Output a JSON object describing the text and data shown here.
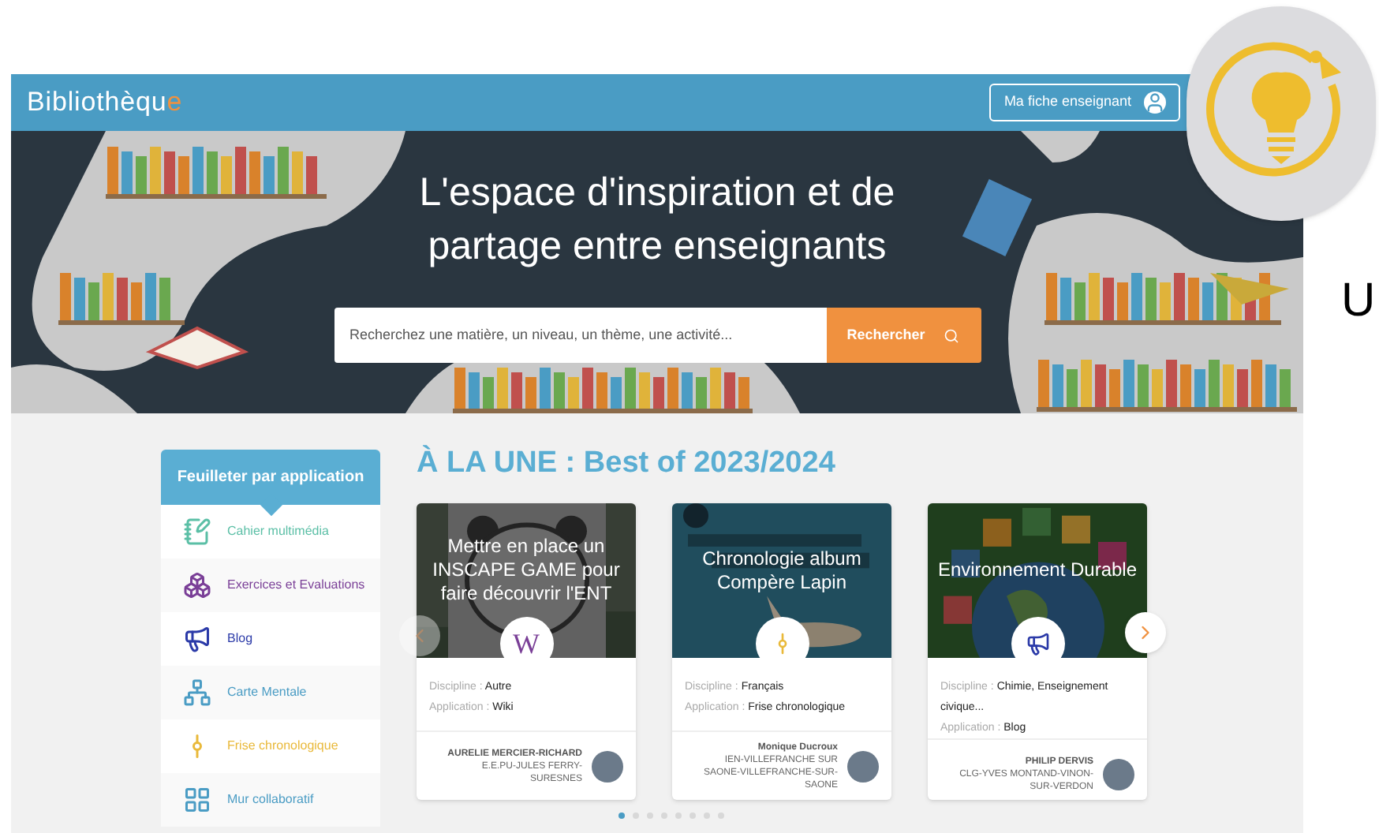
{
  "header": {
    "logo": {
      "text": "Bibliothèqu",
      "accent": "e"
    },
    "profile_button": "Ma fiche enseignant"
  },
  "hero": {
    "title": "L'espace d'inspiration et de partage entre enseignants",
    "search": {
      "placeholder": "Recherchez une matière, un niveau, un thème, une activité...",
      "button": "Rechercher"
    }
  },
  "sidebar": {
    "title": "Feuilleter par application",
    "items": [
      {
        "label": "Cahier multimédia",
        "kind": "notebook",
        "color": "#5bbfa6"
      },
      {
        "label": "Exercices et Evaluations",
        "kind": "cubes",
        "color": "#7a3f97"
      },
      {
        "label": "Blog",
        "kind": "megaphone",
        "color": "#2b3aa8"
      },
      {
        "label": "Carte Mentale",
        "kind": "tree",
        "color": "#4a9cc4"
      },
      {
        "label": "Frise chronologique",
        "kind": "timeline",
        "color": "#e9b93a"
      },
      {
        "label": "Mur collaboratif",
        "kind": "wall",
        "color": "#4a9cc4"
      }
    ]
  },
  "featured": {
    "title": "À LA UNE : Best of 2023/2024",
    "cards": [
      {
        "title": "Mettre en place un INSCAPE GAME pour faire découvrir l'ENT",
        "kind": "wiki",
        "app_letter": "W",
        "discipline_label": "Discipline :",
        "discipline": "Autre",
        "application_label": "Application :",
        "application": "Wiki",
        "author": "AURELIE MERCIER-RICHARD",
        "school": "E.E.PU-JULES FERRY-SURESNES"
      },
      {
        "title": "Chronologie album Compère Lapin",
        "kind": "timeline",
        "discipline_label": "Discipline :",
        "discipline": "Français",
        "application_label": "Application :",
        "application": "Frise chronologique",
        "author": "Monique Ducroux",
        "school": "IEN-VILLEFRANCHE SUR SAONE-VILLEFRANCHE-SUR-SAONE"
      },
      {
        "title": "Environnement Durable",
        "kind": "megaphone",
        "discipline_label": "Discipline :",
        "discipline": "Chimie, Enseignement civique...",
        "application_label": "Application :",
        "application": "Blog",
        "author": "PHILIP DERVIS",
        "school": "CLG-YVES MONTAND-VINON-SUR-VERDON"
      }
    ],
    "dots": [
      {
        "selected": true
      },
      {
        "selected": false
      },
      {
        "selected": false
      },
      {
        "selected": false
      },
      {
        "selected": false
      },
      {
        "selected": false
      },
      {
        "selected": false
      },
      {
        "selected": false
      }
    ]
  },
  "side_text": [
    "U"
  ]
}
